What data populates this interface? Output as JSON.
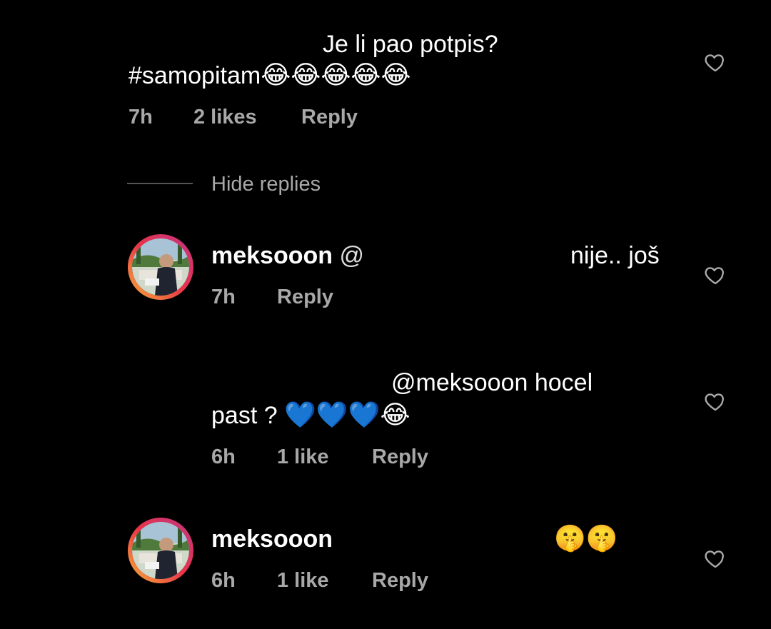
{
  "comment1": {
    "text_line1": "Je li pao potpis?",
    "text_line2_tag": "#samopitam",
    "emojis": "😂😂😂😂😂",
    "time": "7h",
    "likes": "2 likes",
    "reply": "Reply"
  },
  "hide_replies": "Hide replies",
  "reply1": {
    "username": "meksooon",
    "mention_prefix": "@",
    "text_tail": "nije.. još",
    "time": "7h",
    "reply": "Reply"
  },
  "reply2": {
    "mention": "@meksooon",
    "text_tail": "hocel",
    "text_line2": "past ?",
    "emojis": "💙💙💙😂",
    "time": "6h",
    "likes": "1 like",
    "reply": "Reply"
  },
  "reply3": {
    "username": "meksooon",
    "emojis": "🤫🤫",
    "time": "6h",
    "likes": "1 like",
    "reply": "Reply"
  },
  "icons": {
    "heart": "heart-outline-icon",
    "avatar": "profile-avatar"
  },
  "colors": {
    "background": "#000000",
    "text": "#ffffff",
    "meta": "#a8a8a8",
    "avatar_ring_start": "#f9b233",
    "avatar_ring_end": "#c13584"
  }
}
